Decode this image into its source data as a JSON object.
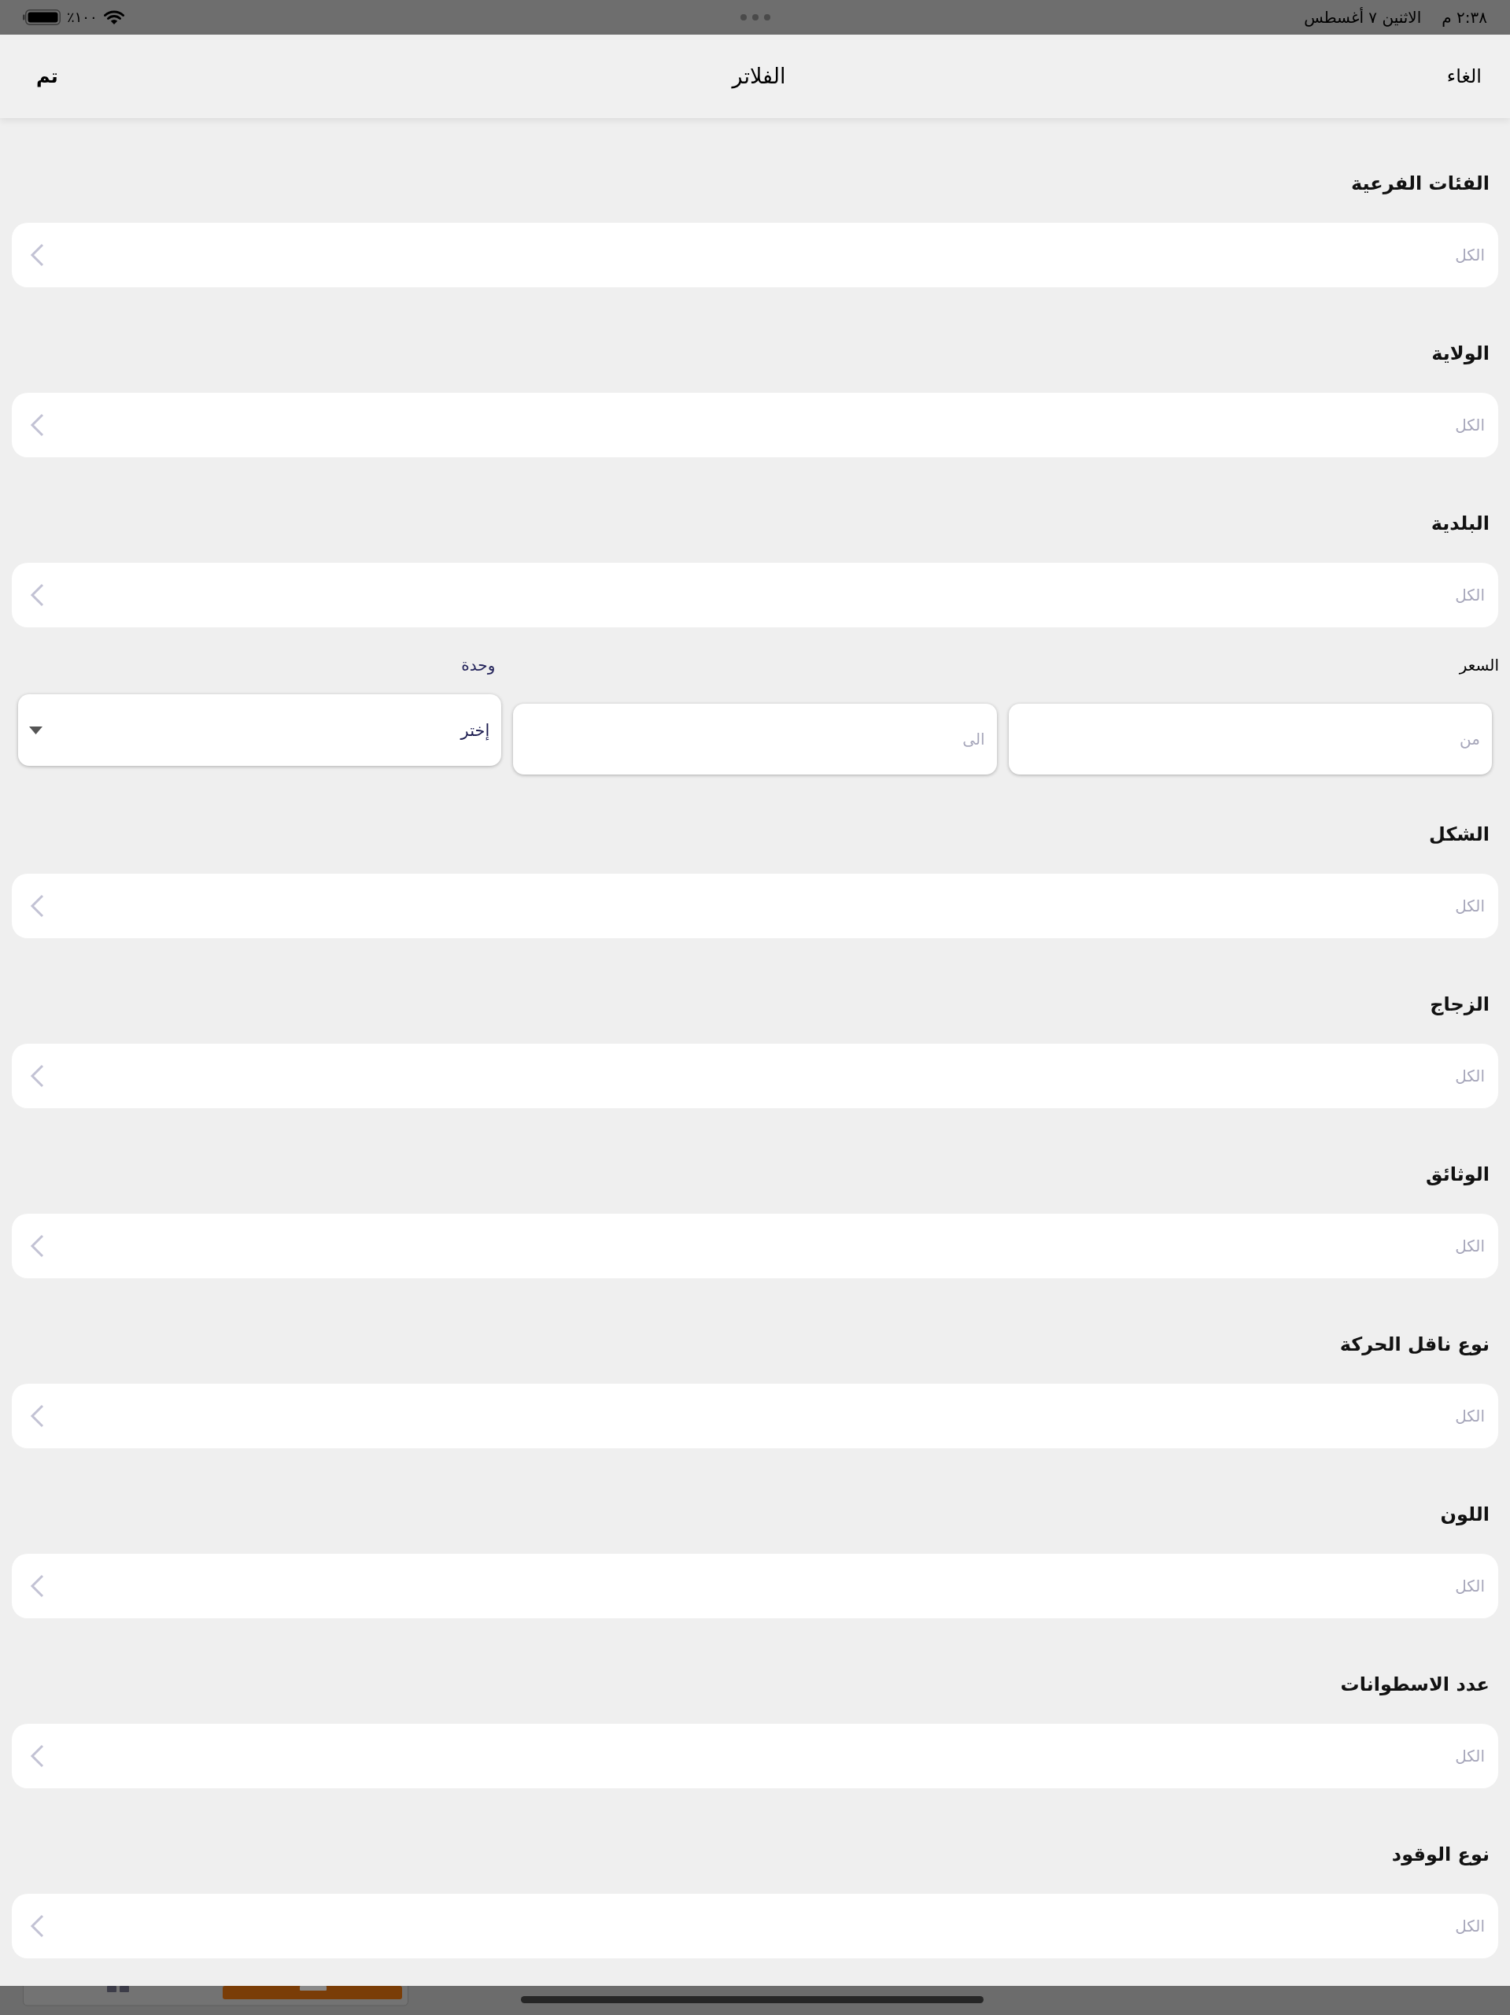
{
  "status_bar": {
    "time": "٢:٣٨ م",
    "date": "الاثنين ٧ أغسطس",
    "battery_percent": "٪١٠٠"
  },
  "header": {
    "cancel_button": "الغاء",
    "title": "الفلاتر",
    "done_button": "تم"
  },
  "filters": [
    {
      "kind": "select",
      "label": "الفئات الفرعية",
      "placeholder": "الكل"
    },
    {
      "kind": "select",
      "label": "الولاية",
      "placeholder": "الكل"
    },
    {
      "kind": "select",
      "label": "البلدية",
      "placeholder": "الكل"
    },
    {
      "kind": "price",
      "label": "السعر",
      "from": {
        "placeholder": "من"
      },
      "to": {
        "placeholder": "الى"
      },
      "unit": {
        "label": "وحدة",
        "value": "إختر"
      }
    },
    {
      "kind": "select",
      "label": "الشكل",
      "placeholder": "الكل"
    },
    {
      "kind": "select",
      "label": "الزجاج",
      "placeholder": "الكل"
    },
    {
      "kind": "select",
      "label": "الوثائق",
      "placeholder": "الكل"
    },
    {
      "kind": "select",
      "label": "نوع ناقل الحركة",
      "placeholder": "الكل"
    },
    {
      "kind": "select",
      "label": "اللون",
      "placeholder": "الكل"
    },
    {
      "kind": "select",
      "label": "عدد الاسطوانات",
      "placeholder": "الكل"
    },
    {
      "kind": "select",
      "label": "نوع الوقود",
      "placeholder": "الكل"
    }
  ]
}
